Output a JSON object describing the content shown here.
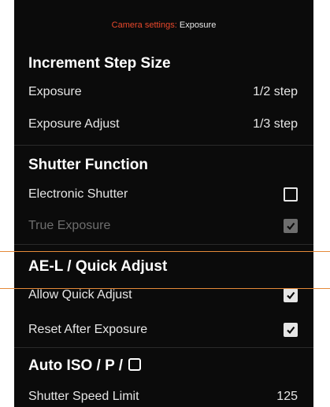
{
  "header": {
    "prefix": "Camera settings:",
    "title": "Exposure"
  },
  "increment": {
    "title": "Increment Step Size",
    "rows": [
      {
        "label": "Exposure",
        "value": "1/2 step"
      },
      {
        "label": "Exposure Adjust",
        "value": "1/3 step"
      }
    ]
  },
  "shutter": {
    "title": "Shutter Function",
    "rows": [
      {
        "label": "Electronic Shutter",
        "checked": false,
        "enabled": true
      },
      {
        "label": "True Exposure",
        "checked": true,
        "enabled": false
      }
    ]
  },
  "ael": {
    "title": "AE-L / Quick Adjust",
    "rows": [
      {
        "label": "Allow Quick Adjust",
        "checked": true
      },
      {
        "label": "Reset After Exposure",
        "checked": true
      }
    ]
  },
  "auto_iso": {
    "title": "Auto ISO / P /",
    "rows": [
      {
        "label": "Shutter Speed Limit",
        "value": "125"
      }
    ]
  },
  "colors": {
    "accent": "#e8482c",
    "highlight_border": "#e58a3a",
    "background": "#0b0b0b"
  }
}
